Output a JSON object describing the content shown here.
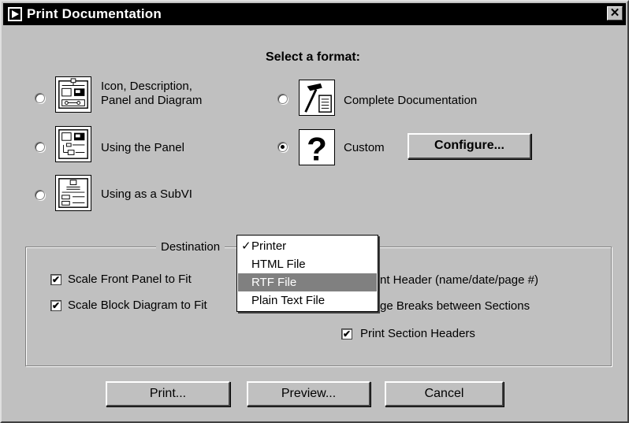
{
  "window": {
    "title": "Print Documentation",
    "close_label": "✕"
  },
  "format": {
    "heading": "Select a format:",
    "options": [
      {
        "line1": "Icon, Description,",
        "line2": "Panel and Diagram",
        "selected": false,
        "icon": "icon-description-icon"
      },
      {
        "line1": "Complete Documentation",
        "selected": false,
        "icon": "hammer-document-icon"
      },
      {
        "line1": "Using the Panel",
        "selected": false,
        "icon": "panel-icon"
      },
      {
        "line1": "Custom",
        "selected": true,
        "icon": "question-mark-icon"
      },
      {
        "line1": "Using as a SubVI",
        "selected": false,
        "icon": "subvi-icon"
      }
    ],
    "configure_label": "Configure...",
    "custom_symbol": "?"
  },
  "destination": {
    "label": "Destination",
    "menu": [
      {
        "label": "Printer",
        "checked": true
      },
      {
        "label": "HTML File",
        "checked": false
      },
      {
        "label": "RTF File",
        "checked": false,
        "highlighted": true
      },
      {
        "label": "Plain Text File",
        "checked": false
      }
    ],
    "check_mark": "✓"
  },
  "options": {
    "scale_front_panel": {
      "label": "Scale Front Panel to Fit",
      "checked": true
    },
    "scale_block_diagram": {
      "label": "Scale Block Diagram to Fit",
      "checked": true
    },
    "print_header": {
      "label": "nt Header (name/date/page #)"
    },
    "page_breaks": {
      "label": "ge Breaks between Sections"
    },
    "section_headers": {
      "label": "Print Section Headers",
      "checked": true
    },
    "check_glyph": "✔"
  },
  "buttons": {
    "print": "Print...",
    "preview": "Preview...",
    "cancel": "Cancel"
  }
}
